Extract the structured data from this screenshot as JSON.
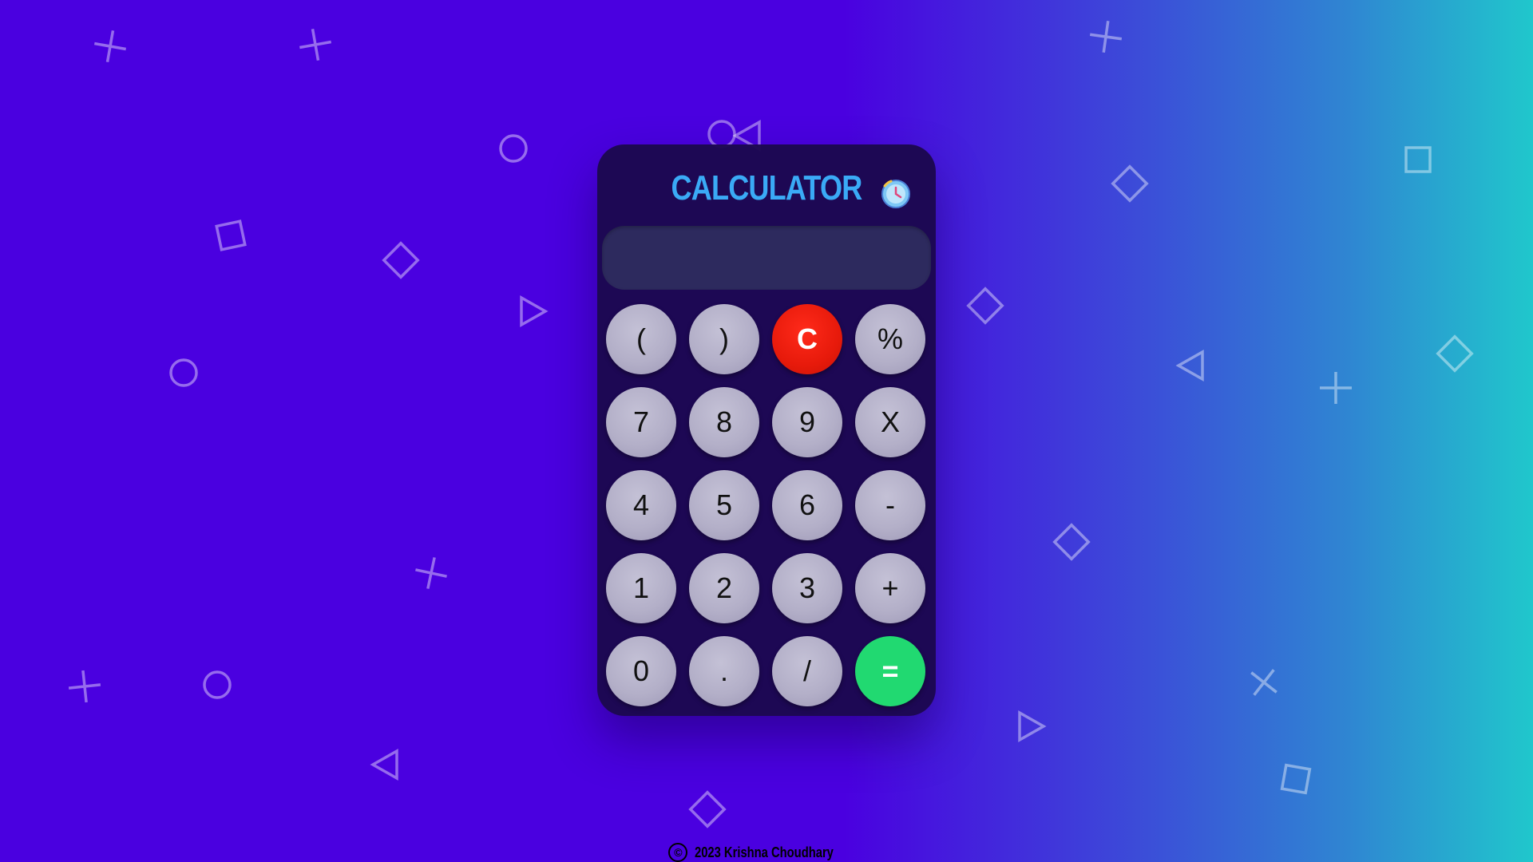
{
  "colors": {
    "background_left": "#4a00e0",
    "background_right": "#20c7cc",
    "calculator_body": "#1c0850",
    "title": "#3aaaf6",
    "display": "#2d2a5e",
    "key": "#b3afc8",
    "clear_key": "#e71a0b",
    "equals_key": "#21d971"
  },
  "calculator": {
    "title": "CALCULATOR",
    "history_icon": "clock-history-icon",
    "display_value": "",
    "keys": [
      {
        "label": "(",
        "type": "normal",
        "name": "open-paren-button"
      },
      {
        "label": ")",
        "type": "normal",
        "name": "close-paren-button"
      },
      {
        "label": "C",
        "type": "clear",
        "name": "clear-button"
      },
      {
        "label": "%",
        "type": "normal",
        "name": "percent-button"
      },
      {
        "label": "7",
        "type": "normal",
        "name": "digit-7-button"
      },
      {
        "label": "8",
        "type": "normal",
        "name": "digit-8-button"
      },
      {
        "label": "9",
        "type": "normal",
        "name": "digit-9-button"
      },
      {
        "label": "X",
        "type": "normal",
        "name": "multiply-button"
      },
      {
        "label": "4",
        "type": "normal",
        "name": "digit-4-button"
      },
      {
        "label": "5",
        "type": "normal",
        "name": "digit-5-button"
      },
      {
        "label": "6",
        "type": "normal",
        "name": "digit-6-button"
      },
      {
        "label": "-",
        "type": "normal",
        "name": "subtract-button"
      },
      {
        "label": "1",
        "type": "normal",
        "name": "digit-1-button"
      },
      {
        "label": "2",
        "type": "normal",
        "name": "digit-2-button"
      },
      {
        "label": "3",
        "type": "normal",
        "name": "digit-3-button"
      },
      {
        "label": "+",
        "type": "normal",
        "name": "add-button"
      },
      {
        "label": "0",
        "type": "normal",
        "name": "digit-0-button"
      },
      {
        "label": ".",
        "type": "normal",
        "name": "decimal-button"
      },
      {
        "label": "/",
        "type": "normal",
        "name": "divide-button"
      },
      {
        "label": "=",
        "type": "equals",
        "name": "equals-button"
      }
    ]
  },
  "footer": {
    "copyright_icon": "copyright-icon",
    "text": "2023 Krishna Choudhary"
  }
}
